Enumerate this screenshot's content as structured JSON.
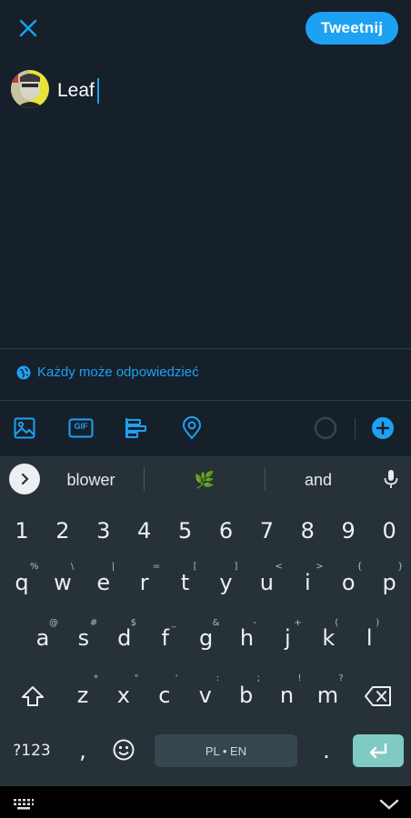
{
  "header": {
    "tweet_button_label": "Tweetnij"
  },
  "composer": {
    "text": "Leaf"
  },
  "reply_setting": {
    "label": "Każdy może odpowiedzieć"
  },
  "toolbar": {
    "icons": [
      "image-icon",
      "gif-icon",
      "poll-icon",
      "location-icon"
    ],
    "gif_label": "GIF"
  },
  "keyboard": {
    "suggestions": [
      "blower",
      "🌿",
      "and"
    ],
    "number_row": [
      "1",
      "2",
      "3",
      "4",
      "5",
      "6",
      "7",
      "8",
      "9",
      "0"
    ],
    "row1": [
      "q",
      "w",
      "e",
      "r",
      "t",
      "y",
      "u",
      "i",
      "o",
      "p"
    ],
    "row1_hints": [
      "%",
      "\\",
      "|",
      "=",
      "[",
      "]",
      "<",
      ">",
      "{",
      "}"
    ],
    "row2": [
      "a",
      "s",
      "d",
      "f",
      "g",
      "h",
      "j",
      "k",
      "l"
    ],
    "row2_hints": [
      "@",
      "#",
      "$",
      "_",
      "&",
      "-",
      "+",
      "(",
      ")"
    ],
    "row3": [
      "z",
      "x",
      "c",
      "v",
      "b",
      "n",
      "m"
    ],
    "row3_hints": [
      "*",
      "\"",
      "'",
      ":",
      ";",
      "!",
      "?"
    ],
    "symbols_label": "?123",
    "comma": ",",
    "period": ".",
    "space_label": "PL • EN"
  },
  "colors": {
    "accent": "#1da1f2",
    "background": "#15202b",
    "keyboard": "#263238",
    "enter": "#7fcbc4"
  }
}
